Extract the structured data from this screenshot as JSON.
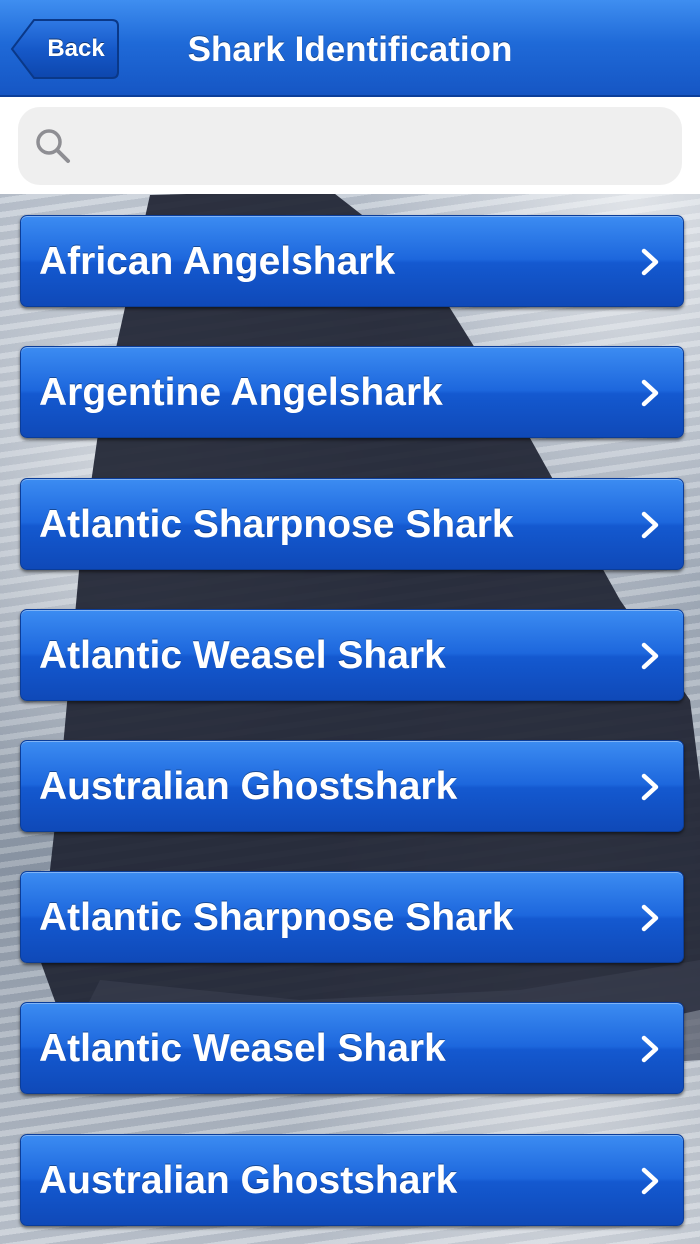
{
  "navbar": {
    "back_label": "Back",
    "title": "Shark Identification",
    "accent_color": "#1f6ad8"
  },
  "search": {
    "value": "",
    "placeholder": "",
    "icon": "search-icon"
  },
  "list": {
    "chevron_icon": "chevron-right-icon",
    "items": [
      {
        "label": "African Angelshark"
      },
      {
        "label": "Argentine Angelshark"
      },
      {
        "label": "Atlantic Sharpnose Shark"
      },
      {
        "label": "Atlantic Weasel Shark"
      },
      {
        "label": "Australian Ghostshark"
      },
      {
        "label": "Atlantic Sharpnose Shark"
      },
      {
        "label": "Atlantic Weasel Shark"
      },
      {
        "label": "Australian Ghostshark"
      }
    ]
  },
  "background": {
    "description_icon": "shark-fin-photo"
  }
}
